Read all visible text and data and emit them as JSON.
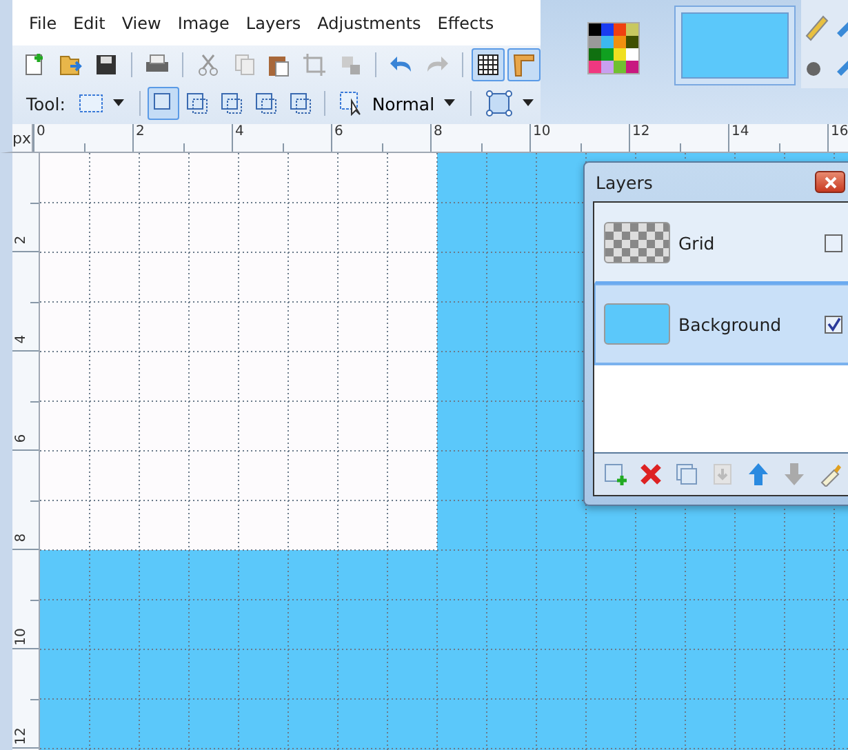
{
  "menu": [
    {
      "label": "File"
    },
    {
      "label": "Edit"
    },
    {
      "label": "View"
    },
    {
      "label": "Image"
    },
    {
      "label": "Layers"
    },
    {
      "label": "Adjustments"
    },
    {
      "label": "Effects"
    }
  ],
  "toolbar": [
    {
      "kind": "new",
      "selected": false
    },
    {
      "kind": "open",
      "selected": false
    },
    {
      "kind": "save",
      "selected": false
    },
    {
      "kind": "separator"
    },
    {
      "kind": "print",
      "selected": false
    },
    {
      "kind": "separator"
    },
    {
      "kind": "cut",
      "selected": false
    },
    {
      "kind": "copy",
      "selected": false
    },
    {
      "kind": "paste",
      "selected": false
    },
    {
      "kind": "crop",
      "selected": false
    },
    {
      "kind": "deselect",
      "selected": false
    },
    {
      "kind": "separator"
    },
    {
      "kind": "undo",
      "selected": false
    },
    {
      "kind": "redo",
      "selected": false
    },
    {
      "kind": "separator"
    },
    {
      "kind": "grid",
      "selected": true
    },
    {
      "kind": "rulers",
      "selected": true
    }
  ],
  "tool_row": {
    "label": "Tool:",
    "selection_modes": [
      {
        "selected": true
      },
      {
        "selected": false
      },
      {
        "selected": false
      },
      {
        "selected": false
      },
      {
        "selected": false
      }
    ],
    "blend_mode": "Normal"
  },
  "primary_swatch": {
    "color": "#5bc8fa"
  },
  "ruler": {
    "unit": "px",
    "x_labels": [
      "0",
      "2",
      "4",
      "6",
      "8",
      "10",
      "12",
      "14",
      "16"
    ],
    "y_labels": [
      "2",
      "4",
      "6",
      "8",
      "10",
      "12"
    ]
  },
  "layers_panel": {
    "title": "Layers",
    "layers": [
      {
        "name": "Grid",
        "kind": "grid",
        "visible": false,
        "selected": false
      },
      {
        "name": "Background",
        "kind": "fill",
        "visible": true,
        "selected": true
      }
    ],
    "buttons": [
      {
        "kind": "add"
      },
      {
        "kind": "delete"
      },
      {
        "kind": "duplicate"
      },
      {
        "kind": "merge"
      },
      {
        "kind": "up"
      },
      {
        "kind": "down"
      },
      {
        "kind": "properties"
      }
    ]
  }
}
